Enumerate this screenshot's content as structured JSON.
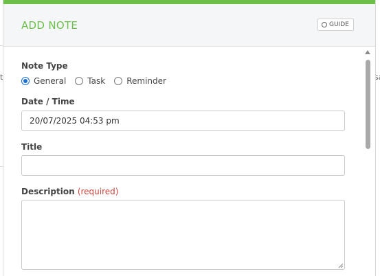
{
  "background": {
    "left_fragment": "t",
    "right_fragment": "sa"
  },
  "modal": {
    "title": "ADD NOTE",
    "guide_label": "GUIDE",
    "accent_color": "#6cc04a"
  },
  "form": {
    "note_type_label": "Note Type",
    "note_type_options": [
      "General",
      "Task",
      "Reminder"
    ],
    "note_type_selected": "General",
    "datetime_label": "Date / Time",
    "datetime_value": "20/07/2025 04:53 pm",
    "title_label": "Title",
    "title_value": "",
    "description_label": "Description",
    "description_required": "(required)",
    "description_value": ""
  }
}
